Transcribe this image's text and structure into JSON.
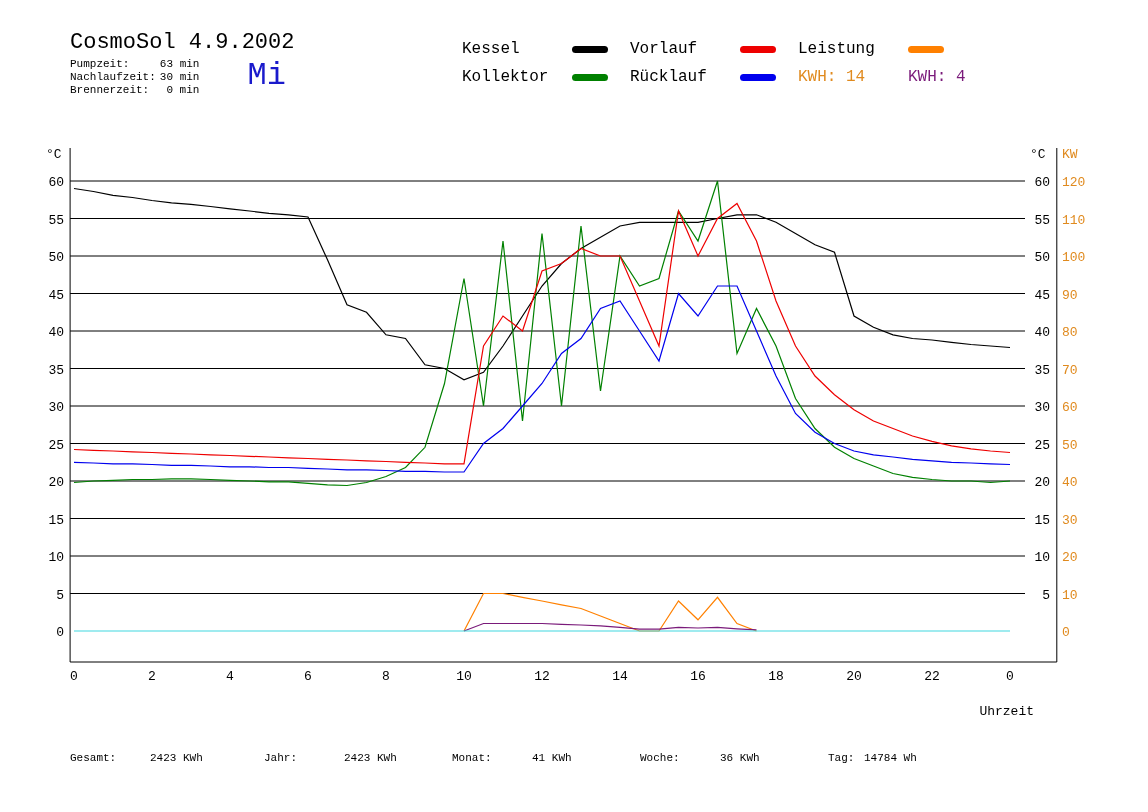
{
  "header": {
    "title": "CosmoSol 4.9.2002",
    "weekday": "Mi",
    "stats": [
      {
        "label": "Pumpzeit:",
        "value": "63 min"
      },
      {
        "label": "Nachlaufzeit:",
        "value": "30 min"
      },
      {
        "label": "Brennerzeit:",
        "value": "0 min"
      }
    ]
  },
  "kwh_labels": [
    {
      "text": "KWH: 14",
      "color": "#e08a1e"
    },
    {
      "text": "KWH: 4",
      "color": "#7a1a7a"
    }
  ],
  "chart": {
    "right_unit": "°C",
    "right_ticks": [
      "60",
      "55",
      "50",
      "45",
      "40",
      "35",
      "30",
      "25",
      "20",
      "15",
      "10",
      "5"
    ],
    "end_tick": "0",
    "chart_data": {
      "type": "line",
      "xlabel": "Uhrzeit",
      "ylabel": "°C",
      "y2label": "KW",
      "xlim": [
        -0.1,
        25.2
      ],
      "ylim": [
        0,
        60
      ],
      "y2lim": [
        0,
        120
      ],
      "x": [
        0,
        0.5,
        1,
        1.5,
        2,
        2.5,
        3,
        3.5,
        4,
        4.5,
        5,
        5.5,
        6,
        6.5,
        7,
        7.5,
        8,
        8.5,
        9,
        9.5,
        10,
        10.5,
        11,
        11.5,
        12,
        12.5,
        13,
        13.5,
        14,
        14.5,
        15,
        15.5,
        16,
        16.5,
        17,
        17.5,
        18,
        18.5,
        19,
        19.5,
        20,
        20.5,
        21,
        21.5,
        22,
        22.5,
        23,
        23.5,
        24
      ],
      "xticks": [
        0,
        2,
        4,
        6,
        8,
        10,
        12,
        14,
        16,
        18,
        20,
        22
      ],
      "yticks": [
        0,
        5,
        10,
        15,
        20,
        25,
        30,
        35,
        40,
        45,
        50,
        55,
        60
      ],
      "y2ticks": [
        0,
        10,
        20,
        30,
        40,
        50,
        60,
        70,
        80,
        90,
        100,
        110,
        120
      ],
      "series": [
        {
          "name": "Kessel",
          "color": "#000000",
          "values": [
            59,
            58.6,
            58.1,
            57.8,
            57.4,
            57.1,
            56.9,
            56.6,
            56.3,
            56,
            55.7,
            55.5,
            55.2,
            49.5,
            43.5,
            42.5,
            39.5,
            39,
            35.5,
            35,
            33.5,
            34.5,
            38,
            42,
            46,
            49,
            51,
            52.5,
            54,
            54.5,
            54.5,
            54.5,
            54.5,
            55,
            55.5,
            55.5,
            54.5,
            53,
            51.5,
            50.5,
            42,
            40.5,
            39.5,
            39,
            38.8,
            38.5,
            38.2,
            38,
            37.8
          ]
        },
        {
          "name": "Kollektor",
          "color": "#008000",
          "values": [
            19.8,
            20,
            20.1,
            20.2,
            20.2,
            20.3,
            20.3,
            20.2,
            20.1,
            20,
            19.9,
            19.9,
            19.7,
            19.5,
            19.4,
            19.8,
            20.6,
            21.8,
            24.5,
            33,
            47,
            30,
            52,
            28,
            53,
            30,
            54,
            32,
            50,
            46,
            47,
            56,
            52,
            60,
            37,
            43,
            38,
            31,
            27,
            24.5,
            23,
            22,
            21,
            20.5,
            20.2,
            20,
            20,
            19.8,
            20
          ]
        },
        {
          "name": "Vorlauf",
          "color": "#ee0000",
          "values": [
            24.2,
            24.1,
            24,
            23.9,
            23.8,
            23.7,
            23.6,
            23.5,
            23.4,
            23.3,
            23.2,
            23.1,
            23,
            22.9,
            22.8,
            22.7,
            22.6,
            22.5,
            22.4,
            22.3,
            22.3,
            38,
            42,
            40,
            48,
            49,
            51,
            50,
            50,
            44,
            38,
            56,
            50,
            55,
            57,
            52,
            44,
            38,
            34,
            31.5,
            29.5,
            28,
            27,
            26,
            25.3,
            24.7,
            24.3,
            24,
            23.8
          ]
        },
        {
          "name": "Rücklauf",
          "color": "#0000ee",
          "values": [
            22.5,
            22.4,
            22.3,
            22.3,
            22.2,
            22.1,
            22.1,
            22,
            21.9,
            21.9,
            21.8,
            21.8,
            21.7,
            21.6,
            21.5,
            21.5,
            21.4,
            21.3,
            21.3,
            21.2,
            21.2,
            25,
            27,
            30,
            33,
            37,
            39,
            43,
            44,
            40,
            36,
            45,
            42,
            46,
            46,
            40,
            34,
            29,
            26.5,
            25,
            24,
            23.5,
            23.2,
            22.9,
            22.7,
            22.5,
            22.4,
            22.3,
            22.2
          ]
        },
        {
          "name": "Leistung",
          "color": "#ff8000",
          "axis": "y2",
          "values": [
            null,
            null,
            null,
            null,
            null,
            null,
            null,
            null,
            null,
            null,
            null,
            null,
            null,
            null,
            null,
            null,
            null,
            null,
            null,
            null,
            0,
            10,
            10,
            9,
            8,
            7,
            6,
            4,
            2,
            0,
            0,
            8,
            3,
            9,
            2,
            0,
            null,
            null,
            null,
            null,
            null,
            null,
            null,
            null,
            null,
            null,
            null,
            null,
            null
          ]
        },
        {
          "color": "#7a1a7a",
          "axis": "y2",
          "values": [
            null,
            null,
            null,
            null,
            null,
            null,
            null,
            null,
            null,
            null,
            null,
            null,
            null,
            null,
            null,
            null,
            null,
            null,
            null,
            null,
            0,
            2,
            2,
            2,
            2,
            1.8,
            1.6,
            1.4,
            1,
            0.5,
            0.5,
            1,
            0.8,
            1,
            0.6,
            0.3,
            null,
            null,
            null,
            null,
            null,
            null,
            null,
            null,
            null,
            null,
            null,
            null,
            null
          ]
        },
        {
          "color": "#40d8e0",
          "values": [
            0,
            0,
            0,
            0,
            0,
            0,
            0,
            0,
            0,
            0,
            0,
            0,
            0,
            0,
            0,
            0,
            0,
            0,
            0,
            0,
            0,
            0,
            0,
            0,
            0,
            0,
            0,
            0,
            0,
            0,
            0,
            0,
            0,
            0,
            0,
            0,
            0,
            0,
            0,
            0,
            0,
            0,
            0,
            0,
            0,
            0,
            0,
            0,
            0
          ]
        }
      ]
    }
  },
  "totals": [
    {
      "label": "Gesamt:",
      "value": "2423 KWh"
    },
    {
      "label": "Jahr:",
      "value": "2423 KWh"
    },
    {
      "label": "Monat:",
      "value": "41 KWh"
    },
    {
      "label": "Woche:",
      "value": "36 KWh"
    },
    {
      "label": "Tag:",
      "value": "14784 Wh"
    }
  ]
}
